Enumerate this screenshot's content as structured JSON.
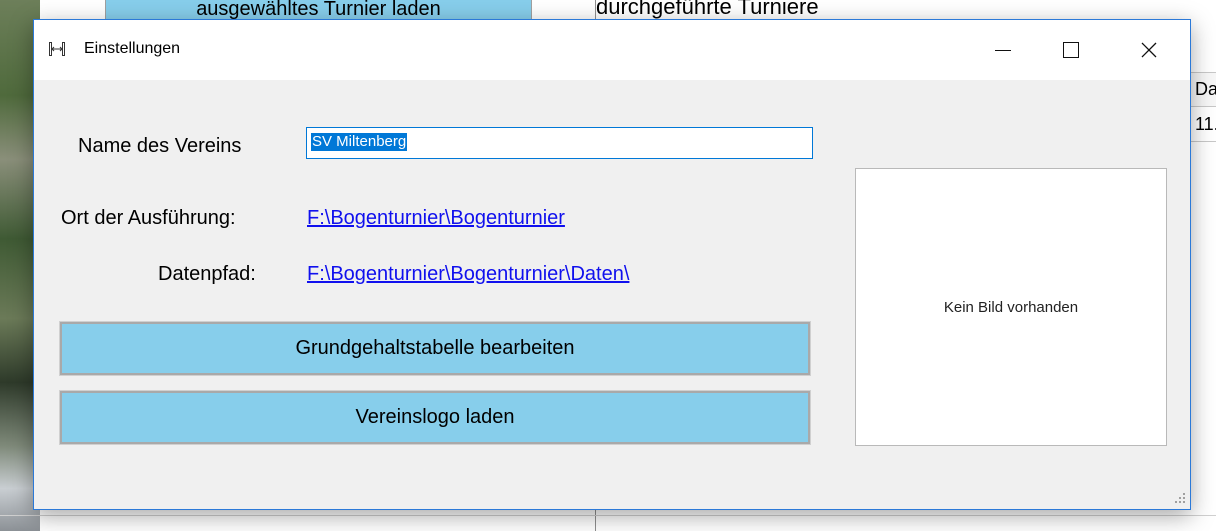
{
  "background": {
    "load_button": "ausgewähltes Turnier laden",
    "heading": "durchgeführte Turniere",
    "grid_header": "Datum",
    "grid_cell": "11."
  },
  "dialog": {
    "title": "Einstellungen",
    "icon": "archery-target-icon",
    "controls": {
      "minimize": "—",
      "maximize": "☐",
      "close": "✕"
    },
    "form": {
      "name_label": "Name des Vereins",
      "name_value": "SV Miltenberg",
      "ort_label": "Ort der Ausführung:",
      "ort_value": "F:\\Bogenturnier\\Bogenturnier",
      "pfad_label": "Datenpfad:",
      "pfad_value": "F:\\Bogenturnier\\Bogenturnier\\Daten\\"
    },
    "buttons": {
      "grundgehalt": "Grundgehaltstabelle bearbeiten",
      "vereinslogo": "Vereinslogo laden"
    },
    "image_placeholder": "Kein Bild vorhanden"
  },
  "colors": {
    "button_fill": "#87ceeb",
    "link": "#1010ee",
    "selection": "#0078d7",
    "window_border": "#2b79d8"
  }
}
